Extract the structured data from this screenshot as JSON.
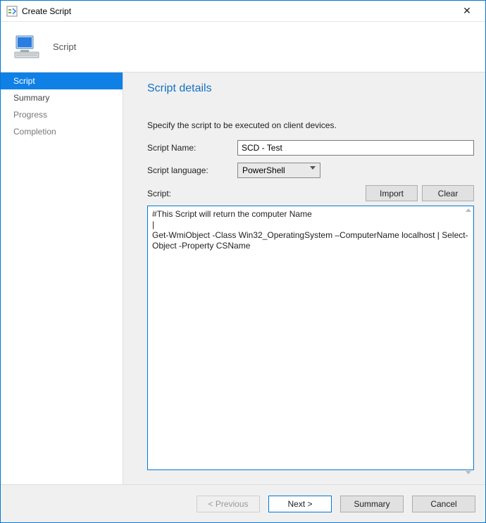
{
  "window": {
    "title": "Create Script",
    "close": "✕"
  },
  "banner": {
    "label": "Script"
  },
  "sidebar": {
    "steps": [
      {
        "label": "Script",
        "active": true
      },
      {
        "label": "Summary",
        "active": false
      },
      {
        "label": "Progress",
        "active": false
      },
      {
        "label": "Completion",
        "active": false
      }
    ]
  },
  "main": {
    "heading": "Script details",
    "hint": "Specify the script to be executed on client devices.",
    "labels": {
      "name": "Script Name:",
      "language": "Script language:",
      "script": "Script:"
    },
    "name_value": "SCD - Test",
    "language_selected": "PowerShell",
    "buttons": {
      "import": "Import",
      "clear": "Clear"
    },
    "script_text": "#This Script will return the computer Name\n|\nGet-WmiObject -Class Win32_OperatingSystem –ComputerName localhost | Select-Object -Property CSName"
  },
  "footer": {
    "previous": "< Previous",
    "next": "Next >",
    "summary": "Summary",
    "cancel": "Cancel"
  }
}
